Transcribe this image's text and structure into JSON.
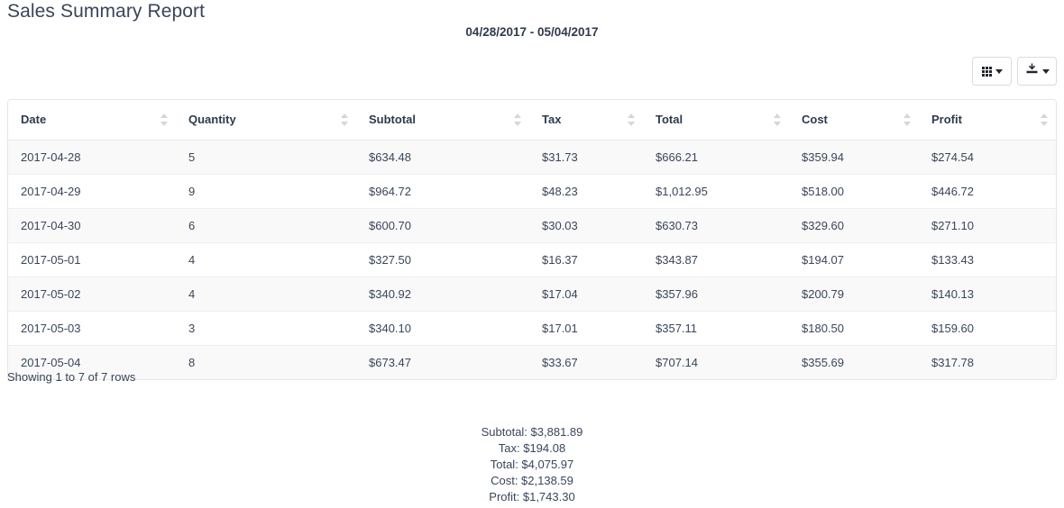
{
  "header": {
    "title": "Sales Summary Report",
    "date_range": "04/28/2017 - 05/04/2017"
  },
  "toolbar": {
    "columns_button": {
      "icon": "grid-icon",
      "caret": "chevron-down-icon"
    },
    "export_button": {
      "icon": "export-icon",
      "caret": "chevron-down-icon"
    }
  },
  "table": {
    "columns": [
      {
        "label": "Date"
      },
      {
        "label": "Quantity"
      },
      {
        "label": "Subtotal"
      },
      {
        "label": "Tax"
      },
      {
        "label": "Total"
      },
      {
        "label": "Cost"
      },
      {
        "label": "Profit"
      }
    ],
    "rows": [
      {
        "date": "2017-04-28",
        "quantity": "5",
        "subtotal": "$634.48",
        "tax": "$31.73",
        "total": "$666.21",
        "cost": "$359.94",
        "profit": "$274.54"
      },
      {
        "date": "2017-04-29",
        "quantity": "9",
        "subtotal": "$964.72",
        "tax": "$48.23",
        "total": "$1,012.95",
        "cost": "$518.00",
        "profit": "$446.72"
      },
      {
        "date": "2017-04-30",
        "quantity": "6",
        "subtotal": "$600.70",
        "tax": "$30.03",
        "total": "$630.73",
        "cost": "$329.60",
        "profit": "$271.10"
      },
      {
        "date": "2017-05-01",
        "quantity": "4",
        "subtotal": "$327.50",
        "tax": "$16.37",
        "total": "$343.87",
        "cost": "$194.07",
        "profit": "$133.43"
      },
      {
        "date": "2017-05-02",
        "quantity": "4",
        "subtotal": "$340.92",
        "tax": "$17.04",
        "total": "$357.96",
        "cost": "$200.79",
        "profit": "$140.13"
      },
      {
        "date": "2017-05-03",
        "quantity": "3",
        "subtotal": "$340.10",
        "tax": "$17.01",
        "total": "$357.11",
        "cost": "$180.50",
        "profit": "$159.60"
      },
      {
        "date": "2017-05-04",
        "quantity": "8",
        "subtotal": "$673.47",
        "tax": "$33.67",
        "total": "$707.14",
        "cost": "$355.69",
        "profit": "$317.78"
      }
    ]
  },
  "footer": {
    "showing": "Showing 1 to 7 of 7 rows",
    "summary": [
      "Subtotal: $3,881.89",
      "Tax: $194.08",
      "Total: $4,075.97",
      "Cost: $2,138.59",
      "Profit: $1,743.30"
    ]
  },
  "colors": {
    "text": "#39465a",
    "heading": "#3a4557",
    "border": "#e4e7ea",
    "stripe": "#f9f9f9",
    "sorter": "#d3d6da"
  }
}
